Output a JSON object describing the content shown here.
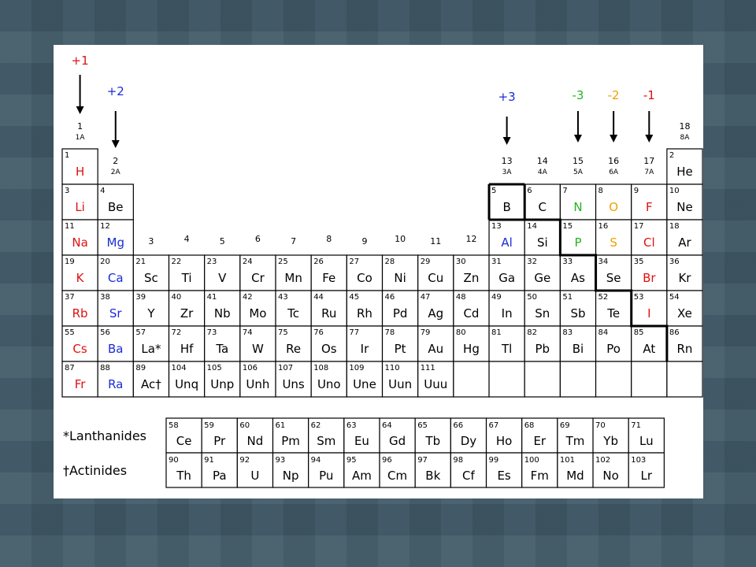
{
  "colors": {
    "red": "#e01010",
    "blue": "#1a2bd6",
    "green": "#22b422",
    "orange": "#f0a000",
    "black": "#000000"
  },
  "charges": [
    {
      "label": "+1",
      "group": 1,
      "color": "#e01010"
    },
    {
      "label": "+2",
      "group": 2,
      "color": "#1a2bd6"
    },
    {
      "label": "+3",
      "group": 13,
      "color": "#1a2bd6"
    },
    {
      "label": "-3",
      "group": 15,
      "color": "#22b422"
    },
    {
      "label": "-2",
      "group": 16,
      "color": "#f0a000"
    },
    {
      "label": "-1",
      "group": 17,
      "color": "#e01010"
    }
  ],
  "group_labels": [
    {
      "group": 1,
      "num": "1",
      "ab": "1A"
    },
    {
      "group": 2,
      "num": "2",
      "ab": "2A"
    },
    {
      "group": 3,
      "num": "3",
      "ab": ""
    },
    {
      "group": 4,
      "num": "4",
      "ab": ""
    },
    {
      "group": 5,
      "num": "5",
      "ab": ""
    },
    {
      "group": 6,
      "num": "6",
      "ab": ""
    },
    {
      "group": 7,
      "num": "7",
      "ab": ""
    },
    {
      "group": 8,
      "num": "8",
      "ab": ""
    },
    {
      "group": 9,
      "num": "9",
      "ab": ""
    },
    {
      "group": 10,
      "num": "10",
      "ab": ""
    },
    {
      "group": 11,
      "num": "11",
      "ab": ""
    },
    {
      "group": 12,
      "num": "12",
      "ab": ""
    },
    {
      "group": 13,
      "num": "13",
      "ab": "3A"
    },
    {
      "group": 14,
      "num": "14",
      "ab": "4A"
    },
    {
      "group": 15,
      "num": "15",
      "ab": "5A"
    },
    {
      "group": 16,
      "num": "16",
      "ab": "6A"
    },
    {
      "group": 17,
      "num": "17",
      "ab": "7A"
    },
    {
      "group": 18,
      "num": "18",
      "ab": "8A"
    }
  ],
  "elements": [
    {
      "z": "1",
      "s": "H",
      "row": 1,
      "col": 1,
      "c": "red"
    },
    {
      "z": "2",
      "s": "He",
      "row": 1,
      "col": 18
    },
    {
      "z": "3",
      "s": "Li",
      "row": 2,
      "col": 1,
      "c": "red"
    },
    {
      "z": "4",
      "s": "Be",
      "row": 2,
      "col": 2
    },
    {
      "z": "5",
      "s": "B",
      "row": 2,
      "col": 13
    },
    {
      "z": "6",
      "s": "C",
      "row": 2,
      "col": 14
    },
    {
      "z": "7",
      "s": "N",
      "row": 2,
      "col": 15,
      "c": "green"
    },
    {
      "z": "8",
      "s": "O",
      "row": 2,
      "col": 16,
      "c": "orange"
    },
    {
      "z": "9",
      "s": "F",
      "row": 2,
      "col": 17,
      "c": "red"
    },
    {
      "z": "10",
      "s": "Ne",
      "row": 2,
      "col": 18
    },
    {
      "z": "11",
      "s": "Na",
      "row": 3,
      "col": 1,
      "c": "red"
    },
    {
      "z": "12",
      "s": "Mg",
      "row": 3,
      "col": 2,
      "c": "blue"
    },
    {
      "z": "13",
      "s": "Al",
      "row": 3,
      "col": 13,
      "c": "blue"
    },
    {
      "z": "14",
      "s": "Si",
      "row": 3,
      "col": 14
    },
    {
      "z": "15",
      "s": "P",
      "row": 3,
      "col": 15,
      "c": "green"
    },
    {
      "z": "16",
      "s": "S",
      "row": 3,
      "col": 16,
      "c": "orange"
    },
    {
      "z": "17",
      "s": "Cl",
      "row": 3,
      "col": 17,
      "c": "red"
    },
    {
      "z": "18",
      "s": "Ar",
      "row": 3,
      "col": 18
    },
    {
      "z": "19",
      "s": "K",
      "row": 4,
      "col": 1,
      "c": "red"
    },
    {
      "z": "20",
      "s": "Ca",
      "row": 4,
      "col": 2,
      "c": "blue"
    },
    {
      "z": "21",
      "s": "Sc",
      "row": 4,
      "col": 3
    },
    {
      "z": "22",
      "s": "Ti",
      "row": 4,
      "col": 4
    },
    {
      "z": "23",
      "s": "V",
      "row": 4,
      "col": 5
    },
    {
      "z": "24",
      "s": "Cr",
      "row": 4,
      "col": 6
    },
    {
      "z": "25",
      "s": "Mn",
      "row": 4,
      "col": 7
    },
    {
      "z": "26",
      "s": "Fe",
      "row": 4,
      "col": 8
    },
    {
      "z": "27",
      "s": "Co",
      "row": 4,
      "col": 9
    },
    {
      "z": "28",
      "s": "Ni",
      "row": 4,
      "col": 10
    },
    {
      "z": "29",
      "s": "Cu",
      "row": 4,
      "col": 11
    },
    {
      "z": "30",
      "s": "Zn",
      "row": 4,
      "col": 12
    },
    {
      "z": "31",
      "s": "Ga",
      "row": 4,
      "col": 13
    },
    {
      "z": "32",
      "s": "Ge",
      "row": 4,
      "col": 14
    },
    {
      "z": "33",
      "s": "As",
      "row": 4,
      "col": 15
    },
    {
      "z": "34",
      "s": "Se",
      "row": 4,
      "col": 16
    },
    {
      "z": "35",
      "s": "Br",
      "row": 4,
      "col": 17,
      "c": "red"
    },
    {
      "z": "36",
      "s": "Kr",
      "row": 4,
      "col": 18
    },
    {
      "z": "37",
      "s": "Rb",
      "row": 5,
      "col": 1,
      "c": "red"
    },
    {
      "z": "38",
      "s": "Sr",
      "row": 5,
      "col": 2,
      "c": "blue"
    },
    {
      "z": "39",
      "s": "Y",
      "row": 5,
      "col": 3
    },
    {
      "z": "40",
      "s": "Zr",
      "row": 5,
      "col": 4
    },
    {
      "z": "41",
      "s": "Nb",
      "row": 5,
      "col": 5
    },
    {
      "z": "42",
      "s": "Mo",
      "row": 5,
      "col": 6
    },
    {
      "z": "43",
      "s": "Tc",
      "row": 5,
      "col": 7
    },
    {
      "z": "44",
      "s": "Ru",
      "row": 5,
      "col": 8
    },
    {
      "z": "45",
      "s": "Rh",
      "row": 5,
      "col": 9
    },
    {
      "z": "46",
      "s": "Pd",
      "row": 5,
      "col": 10
    },
    {
      "z": "47",
      "s": "Ag",
      "row": 5,
      "col": 11
    },
    {
      "z": "48",
      "s": "Cd",
      "row": 5,
      "col": 12
    },
    {
      "z": "49",
      "s": "In",
      "row": 5,
      "col": 13
    },
    {
      "z": "50",
      "s": "Sn",
      "row": 5,
      "col": 14
    },
    {
      "z": "51",
      "s": "Sb",
      "row": 5,
      "col": 15
    },
    {
      "z": "52",
      "s": "Te",
      "row": 5,
      "col": 16
    },
    {
      "z": "53",
      "s": "I",
      "row": 5,
      "col": 17,
      "c": "red"
    },
    {
      "z": "54",
      "s": "Xe",
      "row": 5,
      "col": 18
    },
    {
      "z": "55",
      "s": "Cs",
      "row": 6,
      "col": 1,
      "c": "red"
    },
    {
      "z": "56",
      "s": "Ba",
      "row": 6,
      "col": 2,
      "c": "blue"
    },
    {
      "z": "57",
      "s": "La*",
      "row": 6,
      "col": 3
    },
    {
      "z": "72",
      "s": "Hf",
      "row": 6,
      "col": 4
    },
    {
      "z": "73",
      "s": "Ta",
      "row": 6,
      "col": 5
    },
    {
      "z": "74",
      "s": "W",
      "row": 6,
      "col": 6
    },
    {
      "z": "75",
      "s": "Re",
      "row": 6,
      "col": 7
    },
    {
      "z": "76",
      "s": "Os",
      "row": 6,
      "col": 8
    },
    {
      "z": "77",
      "s": "Ir",
      "row": 6,
      "col": 9
    },
    {
      "z": "78",
      "s": "Pt",
      "row": 6,
      "col": 10
    },
    {
      "z": "79",
      "s": "Au",
      "row": 6,
      "col": 11
    },
    {
      "z": "80",
      "s": "Hg",
      "row": 6,
      "col": 12
    },
    {
      "z": "81",
      "s": "Tl",
      "row": 6,
      "col": 13
    },
    {
      "z": "82",
      "s": "Pb",
      "row": 6,
      "col": 14
    },
    {
      "z": "83",
      "s": "Bi",
      "row": 6,
      "col": 15
    },
    {
      "z": "84",
      "s": "Po",
      "row": 6,
      "col": 16
    },
    {
      "z": "85",
      "s": "At",
      "row": 6,
      "col": 17
    },
    {
      "z": "86",
      "s": "Rn",
      "row": 6,
      "col": 18
    },
    {
      "z": "87",
      "s": "Fr",
      "row": 7,
      "col": 1,
      "c": "red"
    },
    {
      "z": "88",
      "s": "Ra",
      "row": 7,
      "col": 2,
      "c": "blue"
    },
    {
      "z": "89",
      "s": "Ac†",
      "row": 7,
      "col": 3
    },
    {
      "z": "104",
      "s": "Unq",
      "row": 7,
      "col": 4
    },
    {
      "z": "105",
      "s": "Unp",
      "row": 7,
      "col": 5
    },
    {
      "z": "106",
      "s": "Unh",
      "row": 7,
      "col": 6
    },
    {
      "z": "107",
      "s": "Uns",
      "row": 7,
      "col": 7
    },
    {
      "z": "108",
      "s": "Uno",
      "row": 7,
      "col": 8
    },
    {
      "z": "109",
      "s": "Une",
      "row": 7,
      "col": 9
    },
    {
      "z": "110",
      "s": "Uun",
      "row": 7,
      "col": 10
    },
    {
      "z": "111",
      "s": "Uuu",
      "row": 7,
      "col": 11
    },
    {
      "z": "",
      "s": "",
      "row": 7,
      "col": 12
    },
    {
      "z": "",
      "s": "",
      "row": 7,
      "col": 13
    },
    {
      "z": "",
      "s": "",
      "row": 7,
      "col": 14
    },
    {
      "z": "",
      "s": "",
      "row": 7,
      "col": 15
    },
    {
      "z": "",
      "s": "",
      "row": 7,
      "col": 16
    },
    {
      "z": "",
      "s": "",
      "row": 7,
      "col": 17
    },
    {
      "z": "",
      "s": "",
      "row": 7,
      "col": 18
    }
  ],
  "lanthanides": {
    "label": "*Lanthanides",
    "elements": [
      {
        "z": "58",
        "s": "Ce"
      },
      {
        "z": "59",
        "s": "Pr"
      },
      {
        "z": "60",
        "s": "Nd"
      },
      {
        "z": "61",
        "s": "Pm"
      },
      {
        "z": "62",
        "s": "Sm"
      },
      {
        "z": "63",
        "s": "Eu"
      },
      {
        "z": "64",
        "s": "Gd"
      },
      {
        "z": "65",
        "s": "Tb"
      },
      {
        "z": "66",
        "s": "Dy"
      },
      {
        "z": "67",
        "s": "Ho"
      },
      {
        "z": "68",
        "s": "Er"
      },
      {
        "z": "69",
        "s": "Tm"
      },
      {
        "z": "70",
        "s": "Yb"
      },
      {
        "z": "71",
        "s": "Lu"
      }
    ]
  },
  "actinides": {
    "label": "†Actinides",
    "elements": [
      {
        "z": "90",
        "s": "Th"
      },
      {
        "z": "91",
        "s": "Pa"
      },
      {
        "z": "92",
        "s": "U"
      },
      {
        "z": "93",
        "s": "Np"
      },
      {
        "z": "94",
        "s": "Pu"
      },
      {
        "z": "95",
        "s": "Am"
      },
      {
        "z": "96",
        "s": "Cm"
      },
      {
        "z": "97",
        "s": "Bk"
      },
      {
        "z": "98",
        "s": "Cf"
      },
      {
        "z": "99",
        "s": "Es"
      },
      {
        "z": "100",
        "s": "Fm"
      },
      {
        "z": "101",
        "s": "Md"
      },
      {
        "z": "102",
        "s": "No"
      },
      {
        "z": "103",
        "s": "Lr"
      }
    ]
  }
}
